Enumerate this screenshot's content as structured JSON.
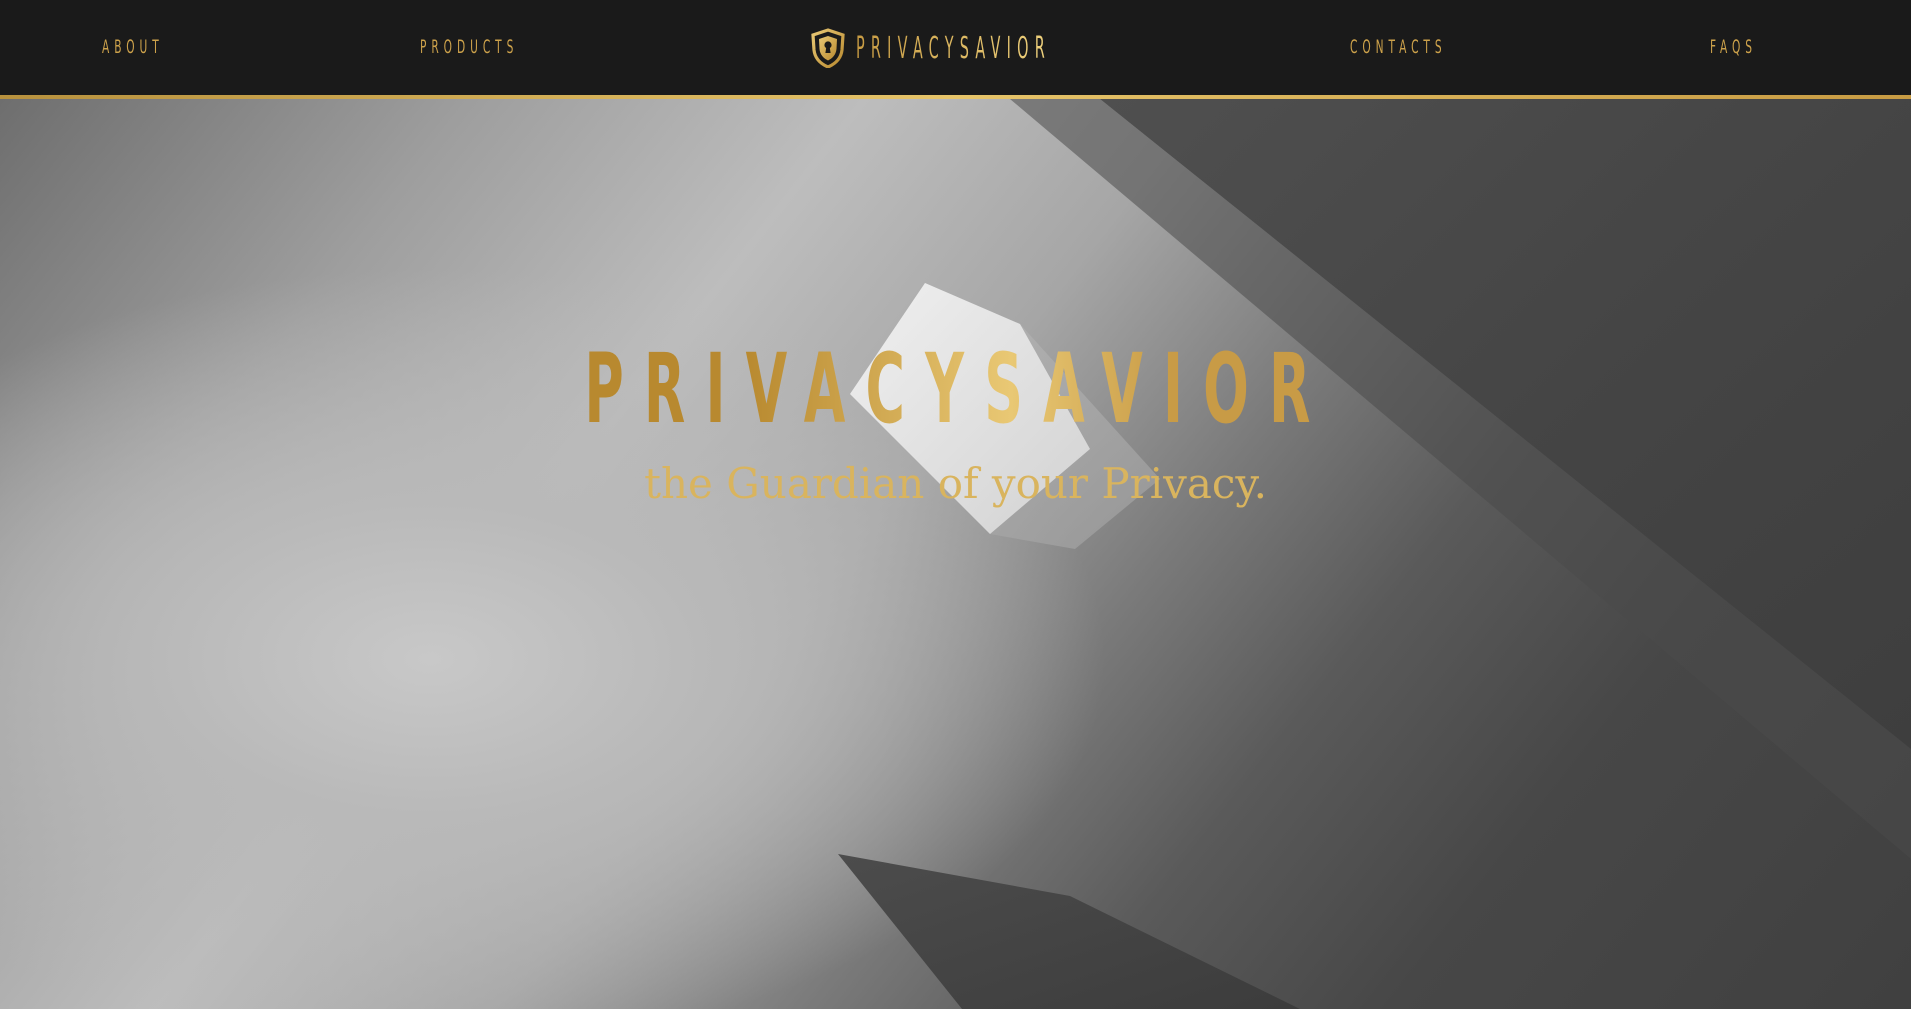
{
  "nav": {
    "about": "ABOUT",
    "products": "PRODUCTS",
    "brand": "PRIVACYSAVIOR",
    "brand_icon": "shield-lock-icon",
    "contacts": "CONTACTS",
    "faqs": "FAQS"
  },
  "hero": {
    "title": "PRIVACYSAVIOR",
    "subtitle": "the Guardian of your Privacy."
  },
  "colors": {
    "accent_gold": "#cda24b",
    "nav_background": "#1a1a1a",
    "hero_dark": "#404040",
    "hero_light": "#c8c8c8"
  }
}
